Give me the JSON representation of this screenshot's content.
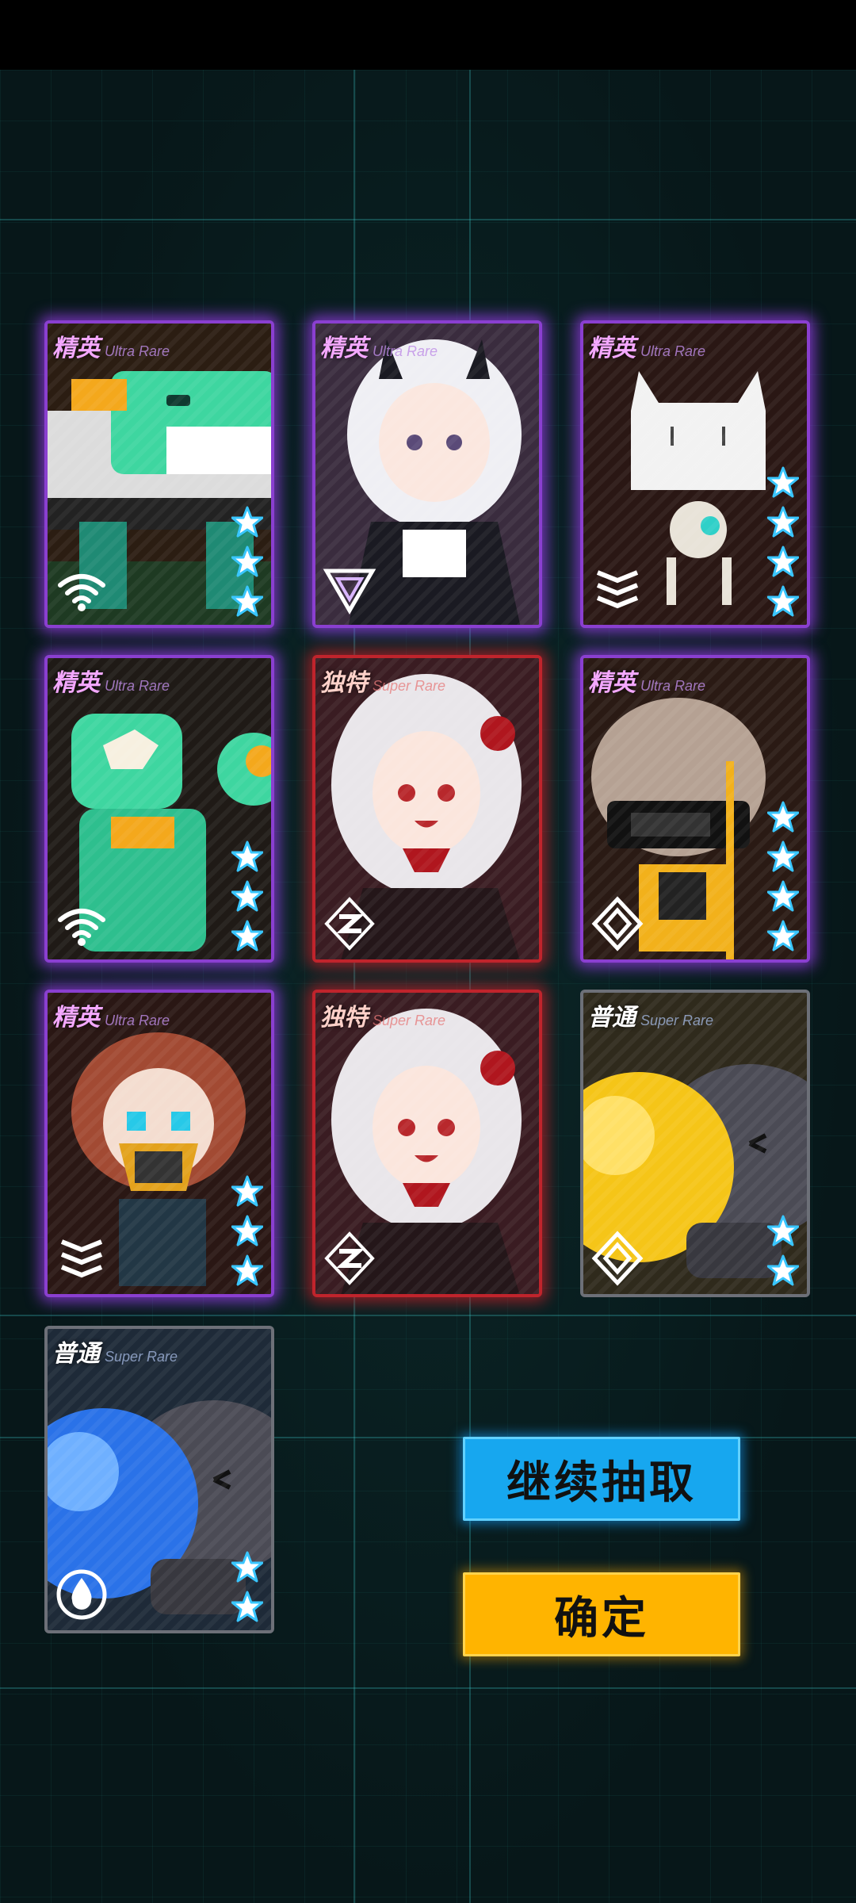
{
  "cards": [
    {
      "rarity_cn": "精英",
      "rarity_en": "Ultra Rare",
      "tier": "elite",
      "stars": 3,
      "art": "mech-green",
      "class_icon": "wifi-icon"
    },
    {
      "rarity_cn": "精英",
      "rarity_en": "Ultra Rare",
      "tier": "elite",
      "stars": 0,
      "art": "girl-white-black",
      "class_icon": "triangle-icon"
    },
    {
      "rarity_cn": "精英",
      "rarity_en": "Ultra Rare",
      "tier": "elite",
      "stars": 4,
      "art": "robot-box",
      "class_icon": "chevron-stack-icon"
    },
    {
      "rarity_cn": "精英",
      "rarity_en": "Ultra Rare",
      "tier": "elite",
      "stars": 3,
      "art": "mech-teal",
      "class_icon": "wifi-icon"
    },
    {
      "rarity_cn": "独特",
      "rarity_en": "Super Rare",
      "tier": "unique",
      "stars": 0,
      "art": "girl-vampire",
      "class_icon": "zigzag-icon"
    },
    {
      "rarity_cn": "精英",
      "rarity_en": "Ultra Rare",
      "tier": "elite",
      "stars": 4,
      "art": "girl-visor",
      "class_icon": "diamond-icon"
    },
    {
      "rarity_cn": "精英",
      "rarity_en": "Ultra Rare",
      "tier": "elite",
      "stars": 3,
      "art": "girl-gasmask",
      "class_icon": "chevron-stack-icon"
    },
    {
      "rarity_cn": "独特",
      "rarity_en": "Super Rare",
      "tier": "unique",
      "stars": 0,
      "art": "girl-vampire",
      "class_icon": "zigzag-icon"
    },
    {
      "rarity_cn": "普通",
      "rarity_en": "Super Rare",
      "tier": "common",
      "stars": 2,
      "art": "bomb-yellow",
      "class_icon": "diamond-icon"
    },
    {
      "rarity_cn": "普通",
      "rarity_en": "Super Rare",
      "tier": "common",
      "stars": 2,
      "art": "bomb-blue",
      "class_icon": "drop-icon"
    }
  ],
  "buttons": {
    "continue_label": "继续抽取",
    "confirm_label": "确定"
  },
  "colors": {
    "elite_glow": "#8a3fd0",
    "unique_glow": "#c0242c",
    "continue_button": "#17a7ef",
    "confirm_button": "#ffb400",
    "star": "#ffffff"
  }
}
